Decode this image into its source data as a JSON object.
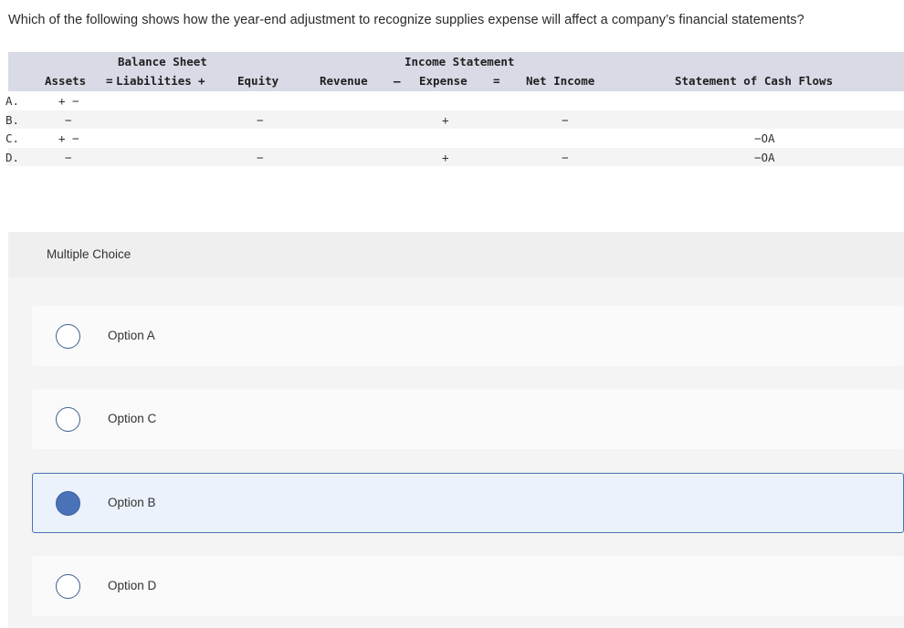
{
  "question": "Which of the following shows how the year-end adjustment to recognize supplies expense will affect a company’s financial statements?",
  "table": {
    "group_headers": {
      "balance_sheet": "Balance Sheet",
      "income_statement": "Income Statement"
    },
    "columns": {
      "assets": "Assets",
      "eq1": "=",
      "liabilities": "Liabilities",
      "plus": "+",
      "equity": "Equity",
      "revenue": "Revenue",
      "minus": "–",
      "expense": "Expense",
      "eq2": "=",
      "net_income": "Net Income",
      "cash_flows": "Statement of Cash Flows"
    },
    "rows": [
      {
        "label": "A.",
        "assets": "+ −",
        "liabilities": "",
        "equity": "",
        "revenue": "",
        "expense": "",
        "net_income": "",
        "cash_flows": ""
      },
      {
        "label": "B.",
        "assets": "−",
        "liabilities": "",
        "equity": "−",
        "revenue": "",
        "expense": "+",
        "net_income": "−",
        "cash_flows": ""
      },
      {
        "label": "C.",
        "assets": "+ −",
        "liabilities": "",
        "equity": "",
        "revenue": "",
        "expense": "",
        "net_income": "",
        "cash_flows": "−OA"
      },
      {
        "label": "D.",
        "assets": "−",
        "liabilities": "",
        "equity": "−",
        "revenue": "",
        "expense": "+",
        "net_income": "−",
        "cash_flows": "−OA"
      }
    ]
  },
  "multiple_choice": {
    "heading": "Multiple Choice",
    "options": [
      {
        "label": "Option A",
        "selected": false
      },
      {
        "label": "Option C",
        "selected": false
      },
      {
        "label": "Option B",
        "selected": true
      },
      {
        "label": "Option D",
        "selected": false
      }
    ]
  },
  "colors": {
    "header_band": "#d8dae6",
    "selected_fill": "#4a72b8",
    "selected_bg": "#ebf2fc",
    "selected_border": "#4a72b0"
  }
}
